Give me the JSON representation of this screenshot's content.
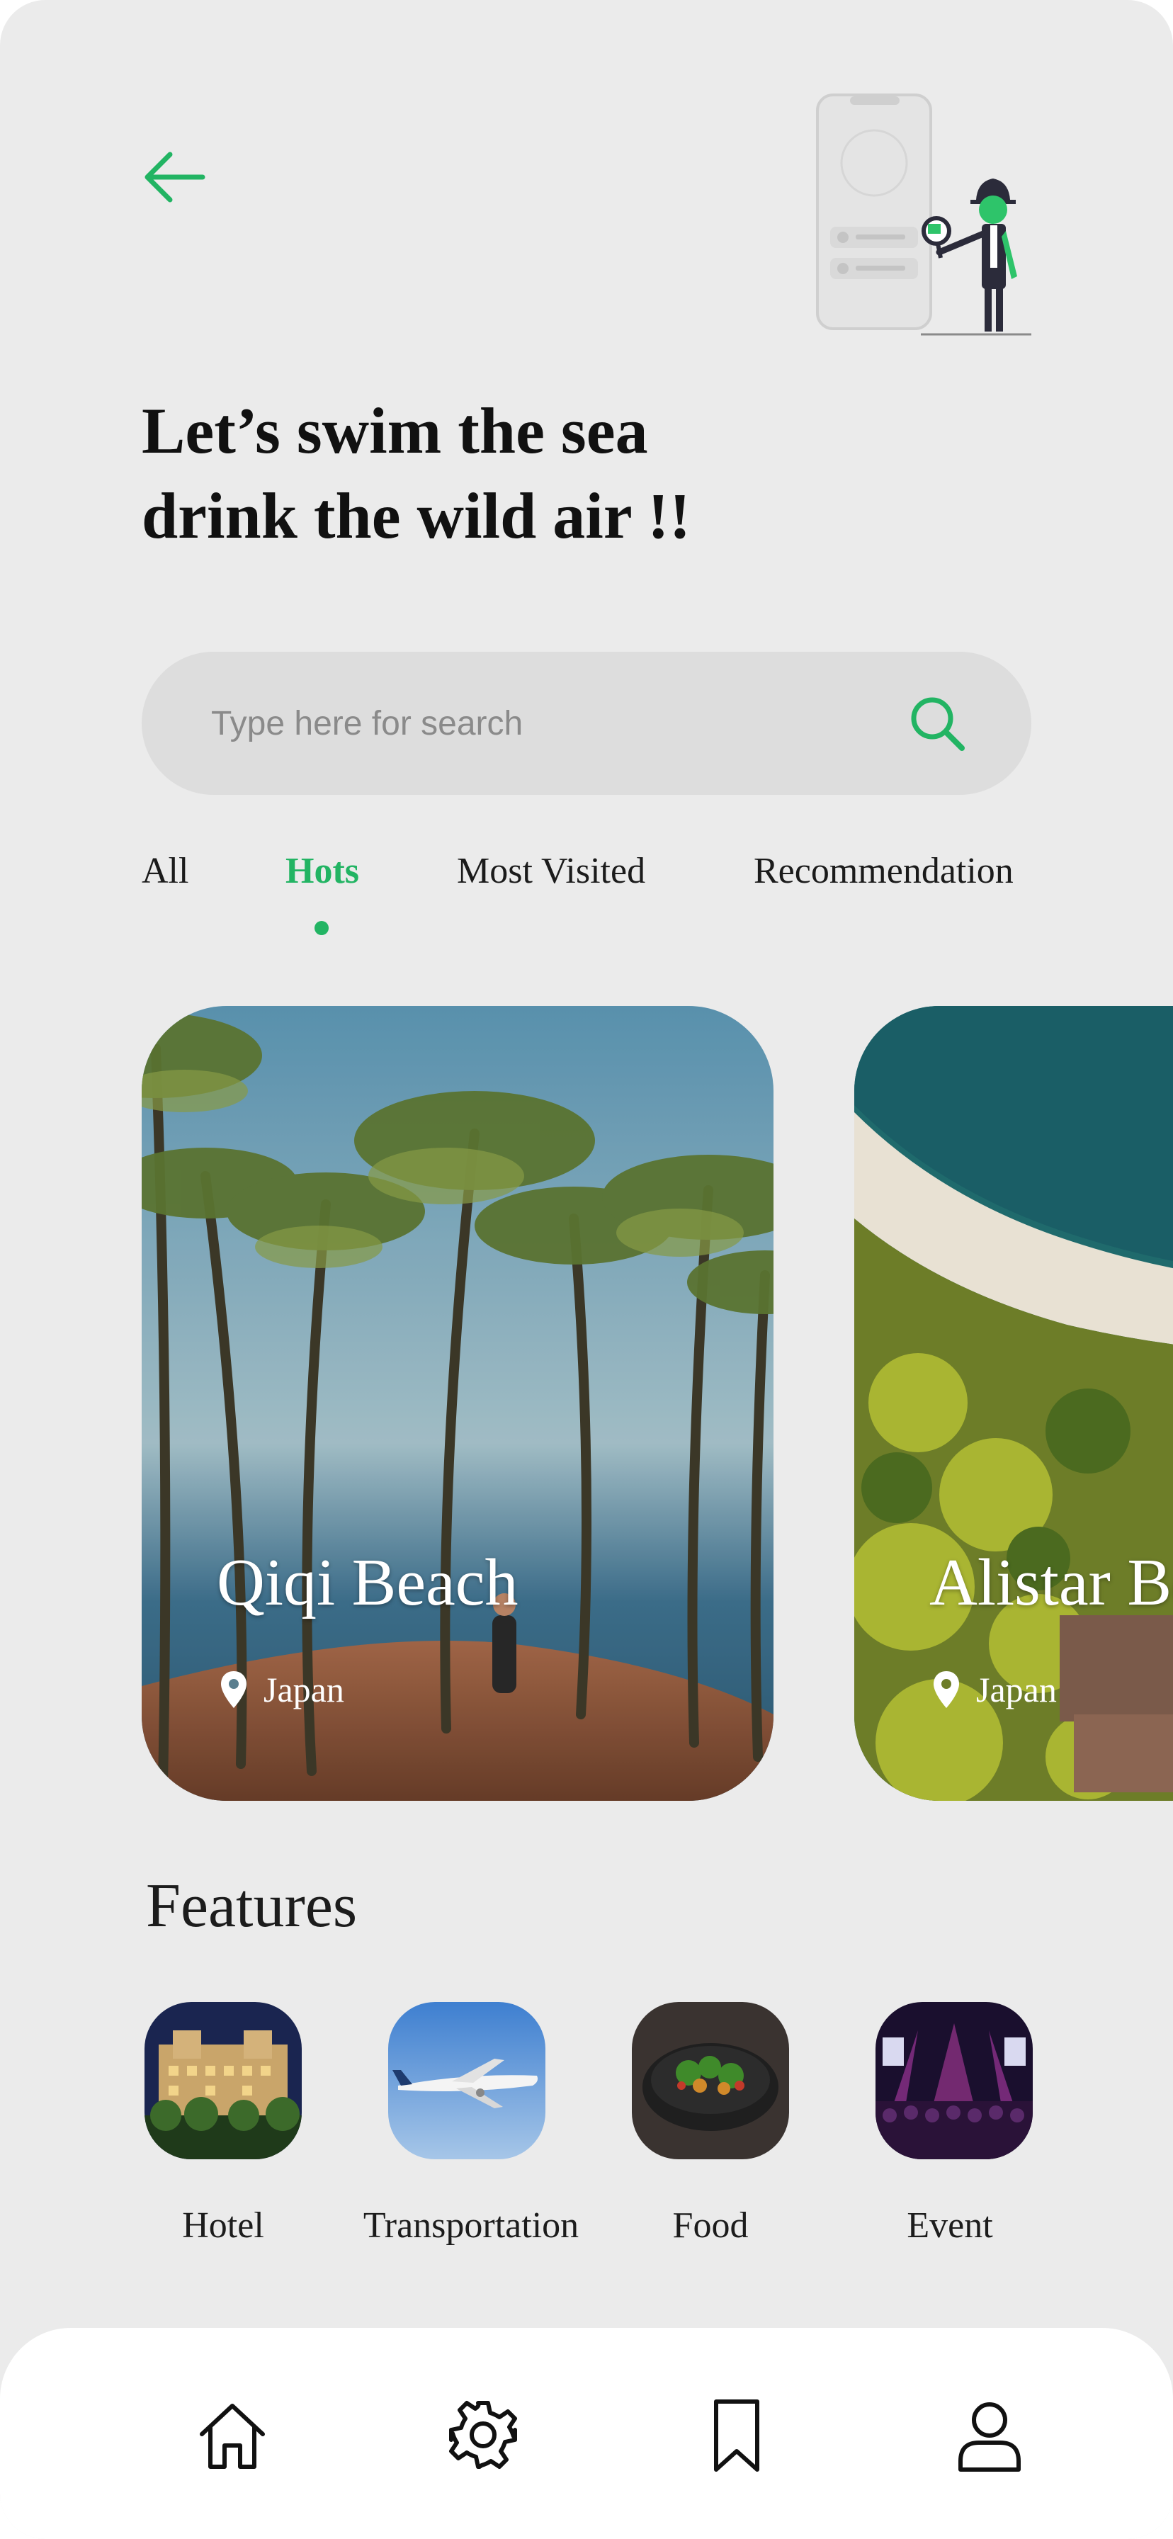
{
  "header": {
    "title_line1": "Let’s swim the sea",
    "title_line2": "drink the wild air !!"
  },
  "search": {
    "placeholder": "Type here for search"
  },
  "tabs": [
    {
      "label": "All",
      "active": false
    },
    {
      "label": "Hots",
      "active": true
    },
    {
      "label": "Most Visited",
      "active": false
    },
    {
      "label": "Recommendation",
      "active": false
    }
  ],
  "destinations": [
    {
      "name": "Qiqi Beach",
      "location": "Japan"
    },
    {
      "name": "Alistar Beach",
      "location": "Japan"
    }
  ],
  "features": {
    "title": "Features",
    "items": [
      {
        "label": "Hotel",
        "icon": "hotel-photo"
      },
      {
        "label": "Transportation",
        "icon": "airplane-photo"
      },
      {
        "label": "Food",
        "icon": "food-bowl-photo"
      },
      {
        "label": "Event",
        "icon": "concert-photo"
      }
    ]
  },
  "nav": {
    "items": [
      {
        "icon": "home-icon"
      },
      {
        "icon": "gear-icon"
      },
      {
        "icon": "bookmark-icon"
      },
      {
        "icon": "user-icon"
      }
    ]
  },
  "colors": {
    "accent": "#22b463",
    "background": "#ebebeb",
    "text": "#111111"
  }
}
